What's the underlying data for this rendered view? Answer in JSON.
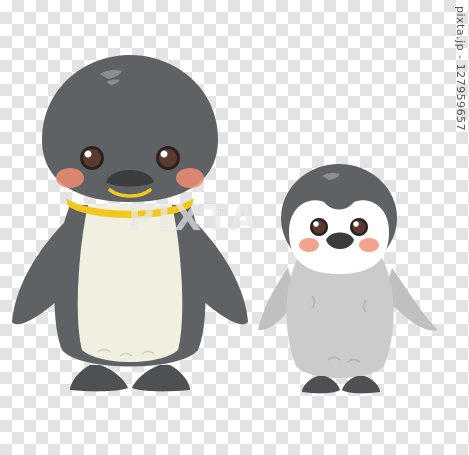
{
  "image": {
    "kind": "illustration",
    "subject": "adult king penguin and fluffy chick"
  },
  "watermark": {
    "text": "PIXTA"
  },
  "side_label": {
    "text": "pixta.jp - 127959657"
  },
  "colors": {
    "background_check_light": "#ffffff",
    "background_check_dark": "#e3e3e3",
    "adult_dark_gray": "#5e6264",
    "adult_belly_cream": "#f1efdf",
    "adult_collar_yellow": "#f2c81e",
    "chick_gray": "#cbcbcb",
    "chick_face_white": "#ffffff",
    "cheek_blush": "#ef8c72",
    "feet_dark": "#4e5153"
  }
}
